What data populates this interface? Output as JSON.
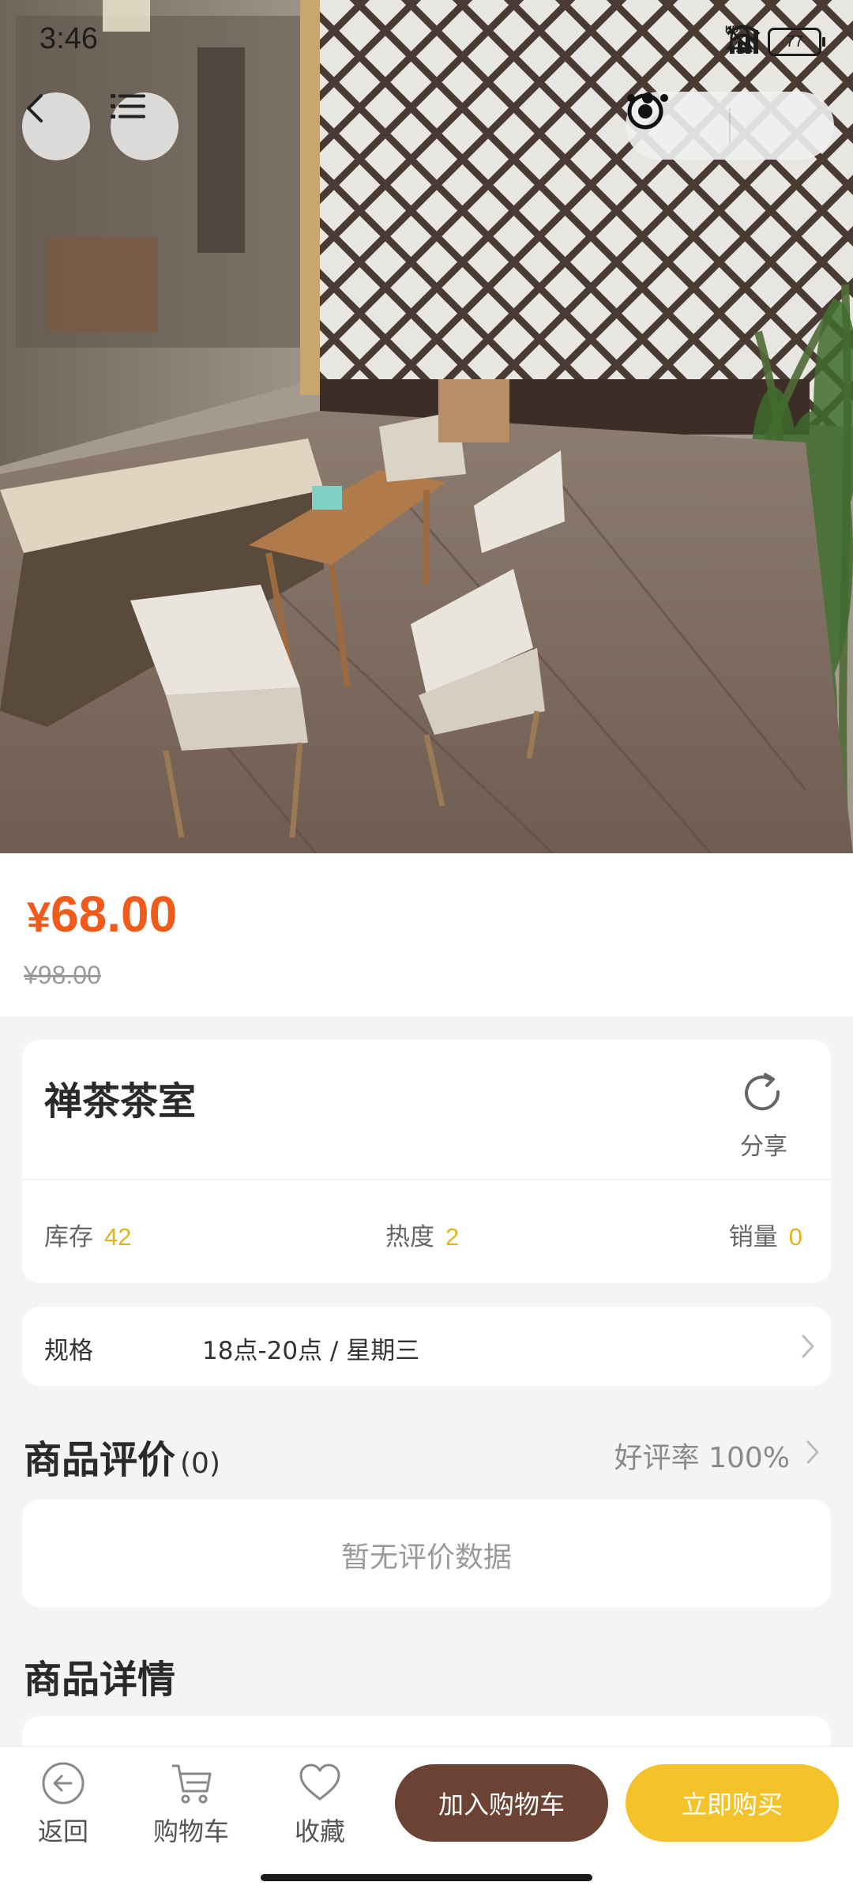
{
  "status_bar": {
    "time": "3:46",
    "battery": "77",
    "icons": [
      "bell-muted-icon",
      "hd-signal-icon",
      "wifi-icon",
      "battery-icon"
    ]
  },
  "nav": {
    "back_icon": "back-arrow-icon",
    "menu_icon": "list-icon",
    "more_icon": "more-dots-icon",
    "close_icon": "target-icon"
  },
  "hero": {
    "image_subject": "patio-with-folding-chairs-photo"
  },
  "price": {
    "current_symbol": "¥",
    "current_value": "68.00",
    "original": "¥98.00"
  },
  "shop": {
    "name": "禅茶茶室",
    "share_label": "分享",
    "stats": [
      {
        "label": "库存",
        "value": "42"
      },
      {
        "label": "热度",
        "value": "2"
      },
      {
        "label": "销量",
        "value": "0"
      }
    ]
  },
  "spec": {
    "label": "规格",
    "value": "18点-20点 / 星期三"
  },
  "reviews": {
    "title": "商品评价",
    "count": "(0)",
    "good_rate": "好评率 100%",
    "empty_text": "暂无评价数据"
  },
  "details": {
    "title": "商品详情"
  },
  "bottom_bar": {
    "back_label": "返回",
    "cart_label": "购物车",
    "favorite_label": "收藏",
    "add_to_cart": "加入购物车",
    "buy_now": "立即购买"
  },
  "colors": {
    "price": "#f05a1a",
    "stat_value": "#e2b31c",
    "add_to_cart_bg": "#6b4234",
    "buy_now_bg": "#f4c32c"
  }
}
